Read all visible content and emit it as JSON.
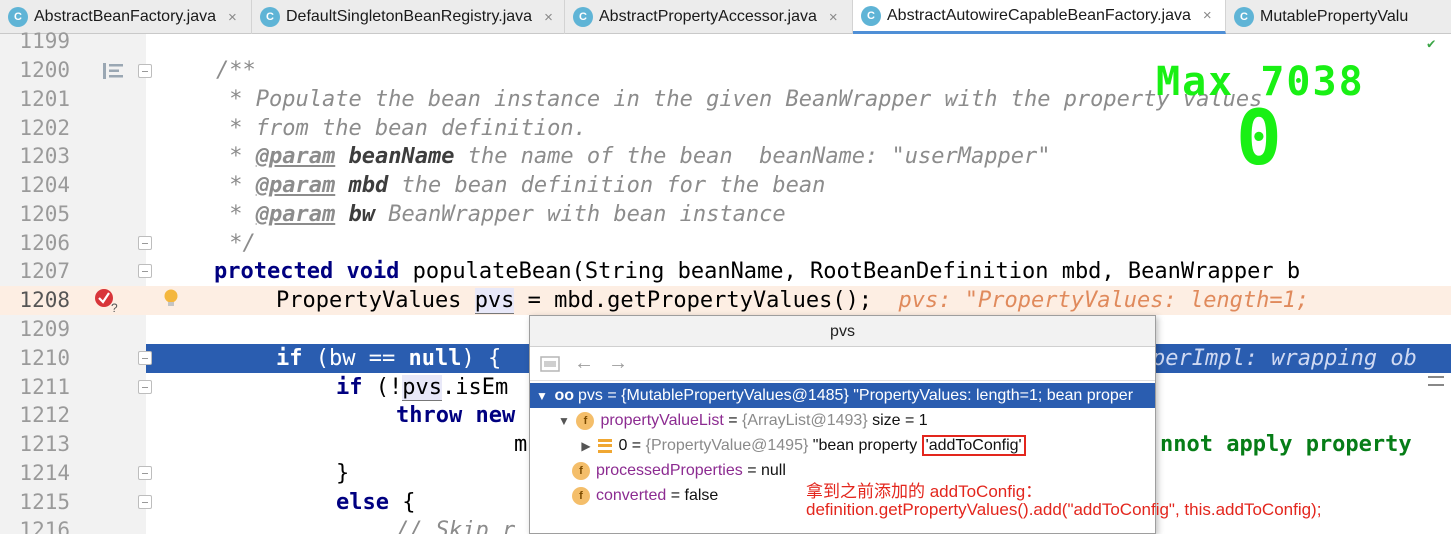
{
  "tabs": [
    {
      "label": "AbstractBeanFactory.java",
      "icon": "C",
      "active": false
    },
    {
      "label": "DefaultSingletonBeanRegistry.java",
      "icon": "C",
      "active": false
    },
    {
      "label": "AbstractPropertyAccessor.java",
      "icon": "C",
      "active": false
    },
    {
      "label": "AbstractAutowireCapableBeanFactory.java",
      "icon": "C",
      "active": true
    },
    {
      "label": "MutablePropertyValu",
      "icon": "C",
      "active": false
    }
  ],
  "close_glyph": "×",
  "line_numbers": [
    "1199",
    "1200",
    "1201",
    "1202",
    "1203",
    "1204",
    "1205",
    "1206",
    "1207",
    "1208",
    "1209",
    "1210",
    "1211",
    "1212",
    "1213",
    "1214",
    "1215",
    "1216"
  ],
  "code": {
    "l1200": "/**",
    "l1201": " * Populate the bean instance in the given BeanWrapper with the property values",
    "l1202": " * from the bean definition.",
    "l1203_star": " * ",
    "l1203_tag": "@param",
    "l1203_name": "beanName",
    "l1203_rest": " the name of the bean  beanName: \"userMapper\"",
    "l1204_star": " * ",
    "l1204_tag": "@param",
    "l1204_name": "mbd",
    "l1204_rest": " the bean definition for the bean",
    "l1205_star": " * ",
    "l1205_tag": "@param",
    "l1205_name": "bw",
    "l1205_rest": " BeanWrapper with bean instance",
    "l1206": " */",
    "l1207_kw": "protected void",
    "l1207_rest": " populateBean(String beanName, RootBeanDefinition mbd, BeanWrapper b",
    "l1208_a": "PropertyValues ",
    "l1208_var": "pvs",
    "l1208_b": " = mbd.getPropertyValues();",
    "l1208_hint": "  pvs: \"PropertyValues: length=1;",
    "l1210_kw": "if",
    "l1210_rest": " (bw == ",
    "l1210_null": "null",
    "l1210_end": ") {",
    "l1210_hint": "perImpl: wrapping ob",
    "l1211_kw": "if",
    "l1211_rest": " (!",
    "l1211_var": "pvs",
    "l1211_end": ".isEm",
    "l1212_kw": "throw new",
    "l1213_m": "m",
    "l1213_tail": "nnot apply property",
    "l1214": "}",
    "l1215_kw": "else",
    "l1215_end": " {",
    "l1216": "// Skip r"
  },
  "popup": {
    "title": "pvs",
    "toolbar": {
      "back": "←",
      "forward": "→"
    },
    "rows": {
      "root": {
        "arrow": "▼",
        "icon": "oo",
        "text": "pvs = {MutablePropertyValues@1485} \"PropertyValues: length=1; bean proper"
      },
      "list": {
        "arrow": "▼",
        "name": "propertyValueList",
        "eq": " = ",
        "ref": "{ArrayList@1493}",
        "extra": "  size = 1"
      },
      "item": {
        "arrow": "▶",
        "index": "0 = ",
        "ref": "{PropertyValue@1495}",
        "pre": " \"bean property ",
        "boxed": "'addToConfig'"
      },
      "processed": {
        "name": "processedProperties",
        "value": " = null"
      },
      "converted": {
        "name": "converted",
        "value": " = false"
      }
    },
    "field_badge": "f"
  },
  "annotation": {
    "line1": "拿到之前添加的 addToConfig：",
    "line2": "definition.getPropertyValues().add(\"addToConfig\", this.addToConfig);"
  },
  "overlay": {
    "max_label": "Max 7038",
    "score": "0"
  },
  "colors": {
    "accent": "#2a5db0",
    "overlay_green": "#19f014",
    "annotation_red": "#e3261d",
    "current_line": "#fdeee3"
  }
}
